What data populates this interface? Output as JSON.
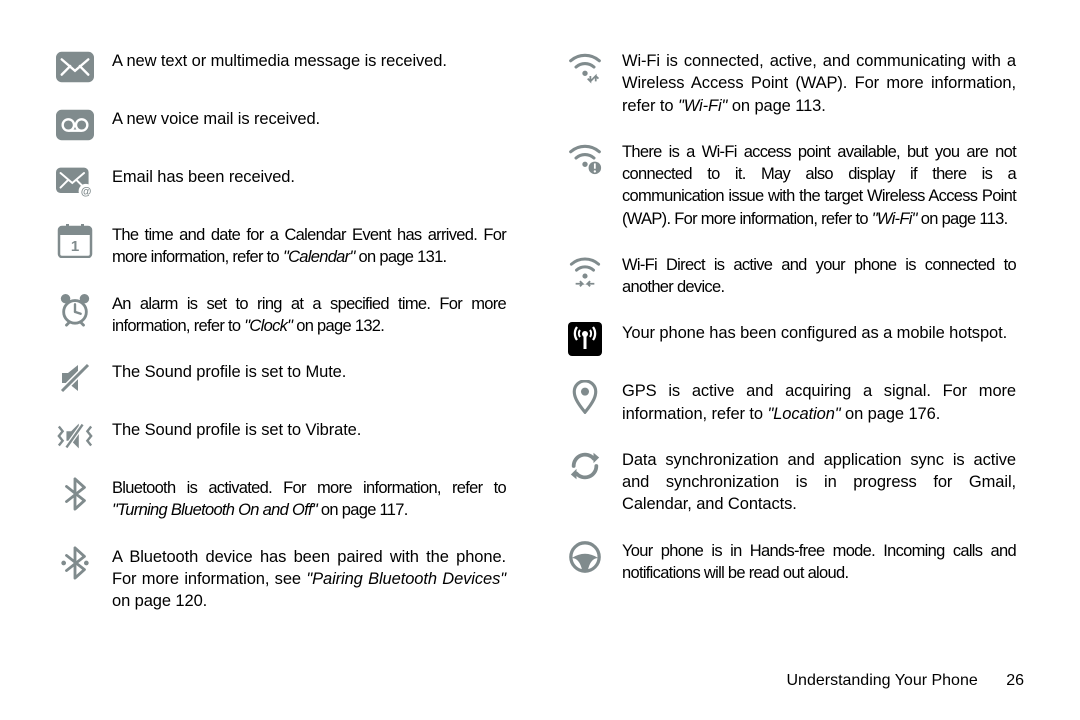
{
  "left": [
    {
      "icon": "message-icon",
      "desc": "A new text or multimedia message is received."
    },
    {
      "icon": "voicemail-icon",
      "desc": "A new voice mail is received."
    },
    {
      "icon": "email-icon",
      "desc": "Email has been received."
    },
    {
      "icon": "calendar-icon",
      "desc": "The time and date for a Calendar Event has arrived. For more information, refer to ",
      "ref_italic": "\"Calendar\" ",
      "ref_plain": "on page 131.",
      "tight": true
    },
    {
      "icon": "alarm-icon",
      "desc": "An alarm is set to ring at a specified time. For more information, refer to ",
      "ref_italic": "\"Clock\" ",
      "ref_plain": "on page 132.",
      "tight": true
    },
    {
      "icon": "mute-icon",
      "desc": "The Sound profile is set to Mute."
    },
    {
      "icon": "vibrate-icon",
      "desc": "The Sound profile is set to Vibrate."
    },
    {
      "icon": "bluetooth-icon",
      "desc": "Bluetooth is activated. For more information, refer to ",
      "ref_italic": "\"Turning Bluetooth On and Off\" ",
      "ref_plain": "on page 117.",
      "tight": true
    },
    {
      "icon": "bluetooth-paired-icon",
      "desc": "A Bluetooth device has been paired with the phone. For more information, see ",
      "ref_italic": "\"Pairing Bluetooth Devices\" ",
      "ref_plain": "on page 120."
    }
  ],
  "right": [
    {
      "icon": "wifi-connected-icon",
      "desc": "Wi-Fi is connected, active, and communicating with a Wireless Access Point (WAP). For more information, refer to ",
      "ref_italic": "\"Wi-Fi\" ",
      "ref_plain": "on page 113."
    },
    {
      "icon": "wifi-warning-icon",
      "desc": "There is a Wi-Fi access point available, but you are not connected to it. May also display if there is a communication issue with the target Wireless Access Point (WAP). For more information, refer to ",
      "ref_italic": "\"Wi-Fi\" ",
      "ref_plain": "on page 113.",
      "tight": true
    },
    {
      "icon": "wifi-direct-icon",
      "desc": "Wi-Fi Direct is active and your phone is connected to another device.",
      "tight": true
    },
    {
      "icon": "hotspot-icon",
      "desc": "Your phone has been configured as a mobile hotspot."
    },
    {
      "icon": "gps-icon",
      "desc": "GPS is active and acquiring a signal. For more information, refer to ",
      "ref_italic": "\"Location\" ",
      "ref_plain": "on page 176."
    },
    {
      "icon": "sync-icon",
      "desc": "Data synchronization and application sync is active and synchronization is in progress for Gmail, Calendar, and Contacts."
    },
    {
      "icon": "handsfree-icon",
      "desc": "Your phone is in Hands-free mode. Incoming calls and notifications will be read out aloud.",
      "tight": true
    }
  ],
  "footer": {
    "section": "Understanding Your Phone",
    "page": "26"
  }
}
